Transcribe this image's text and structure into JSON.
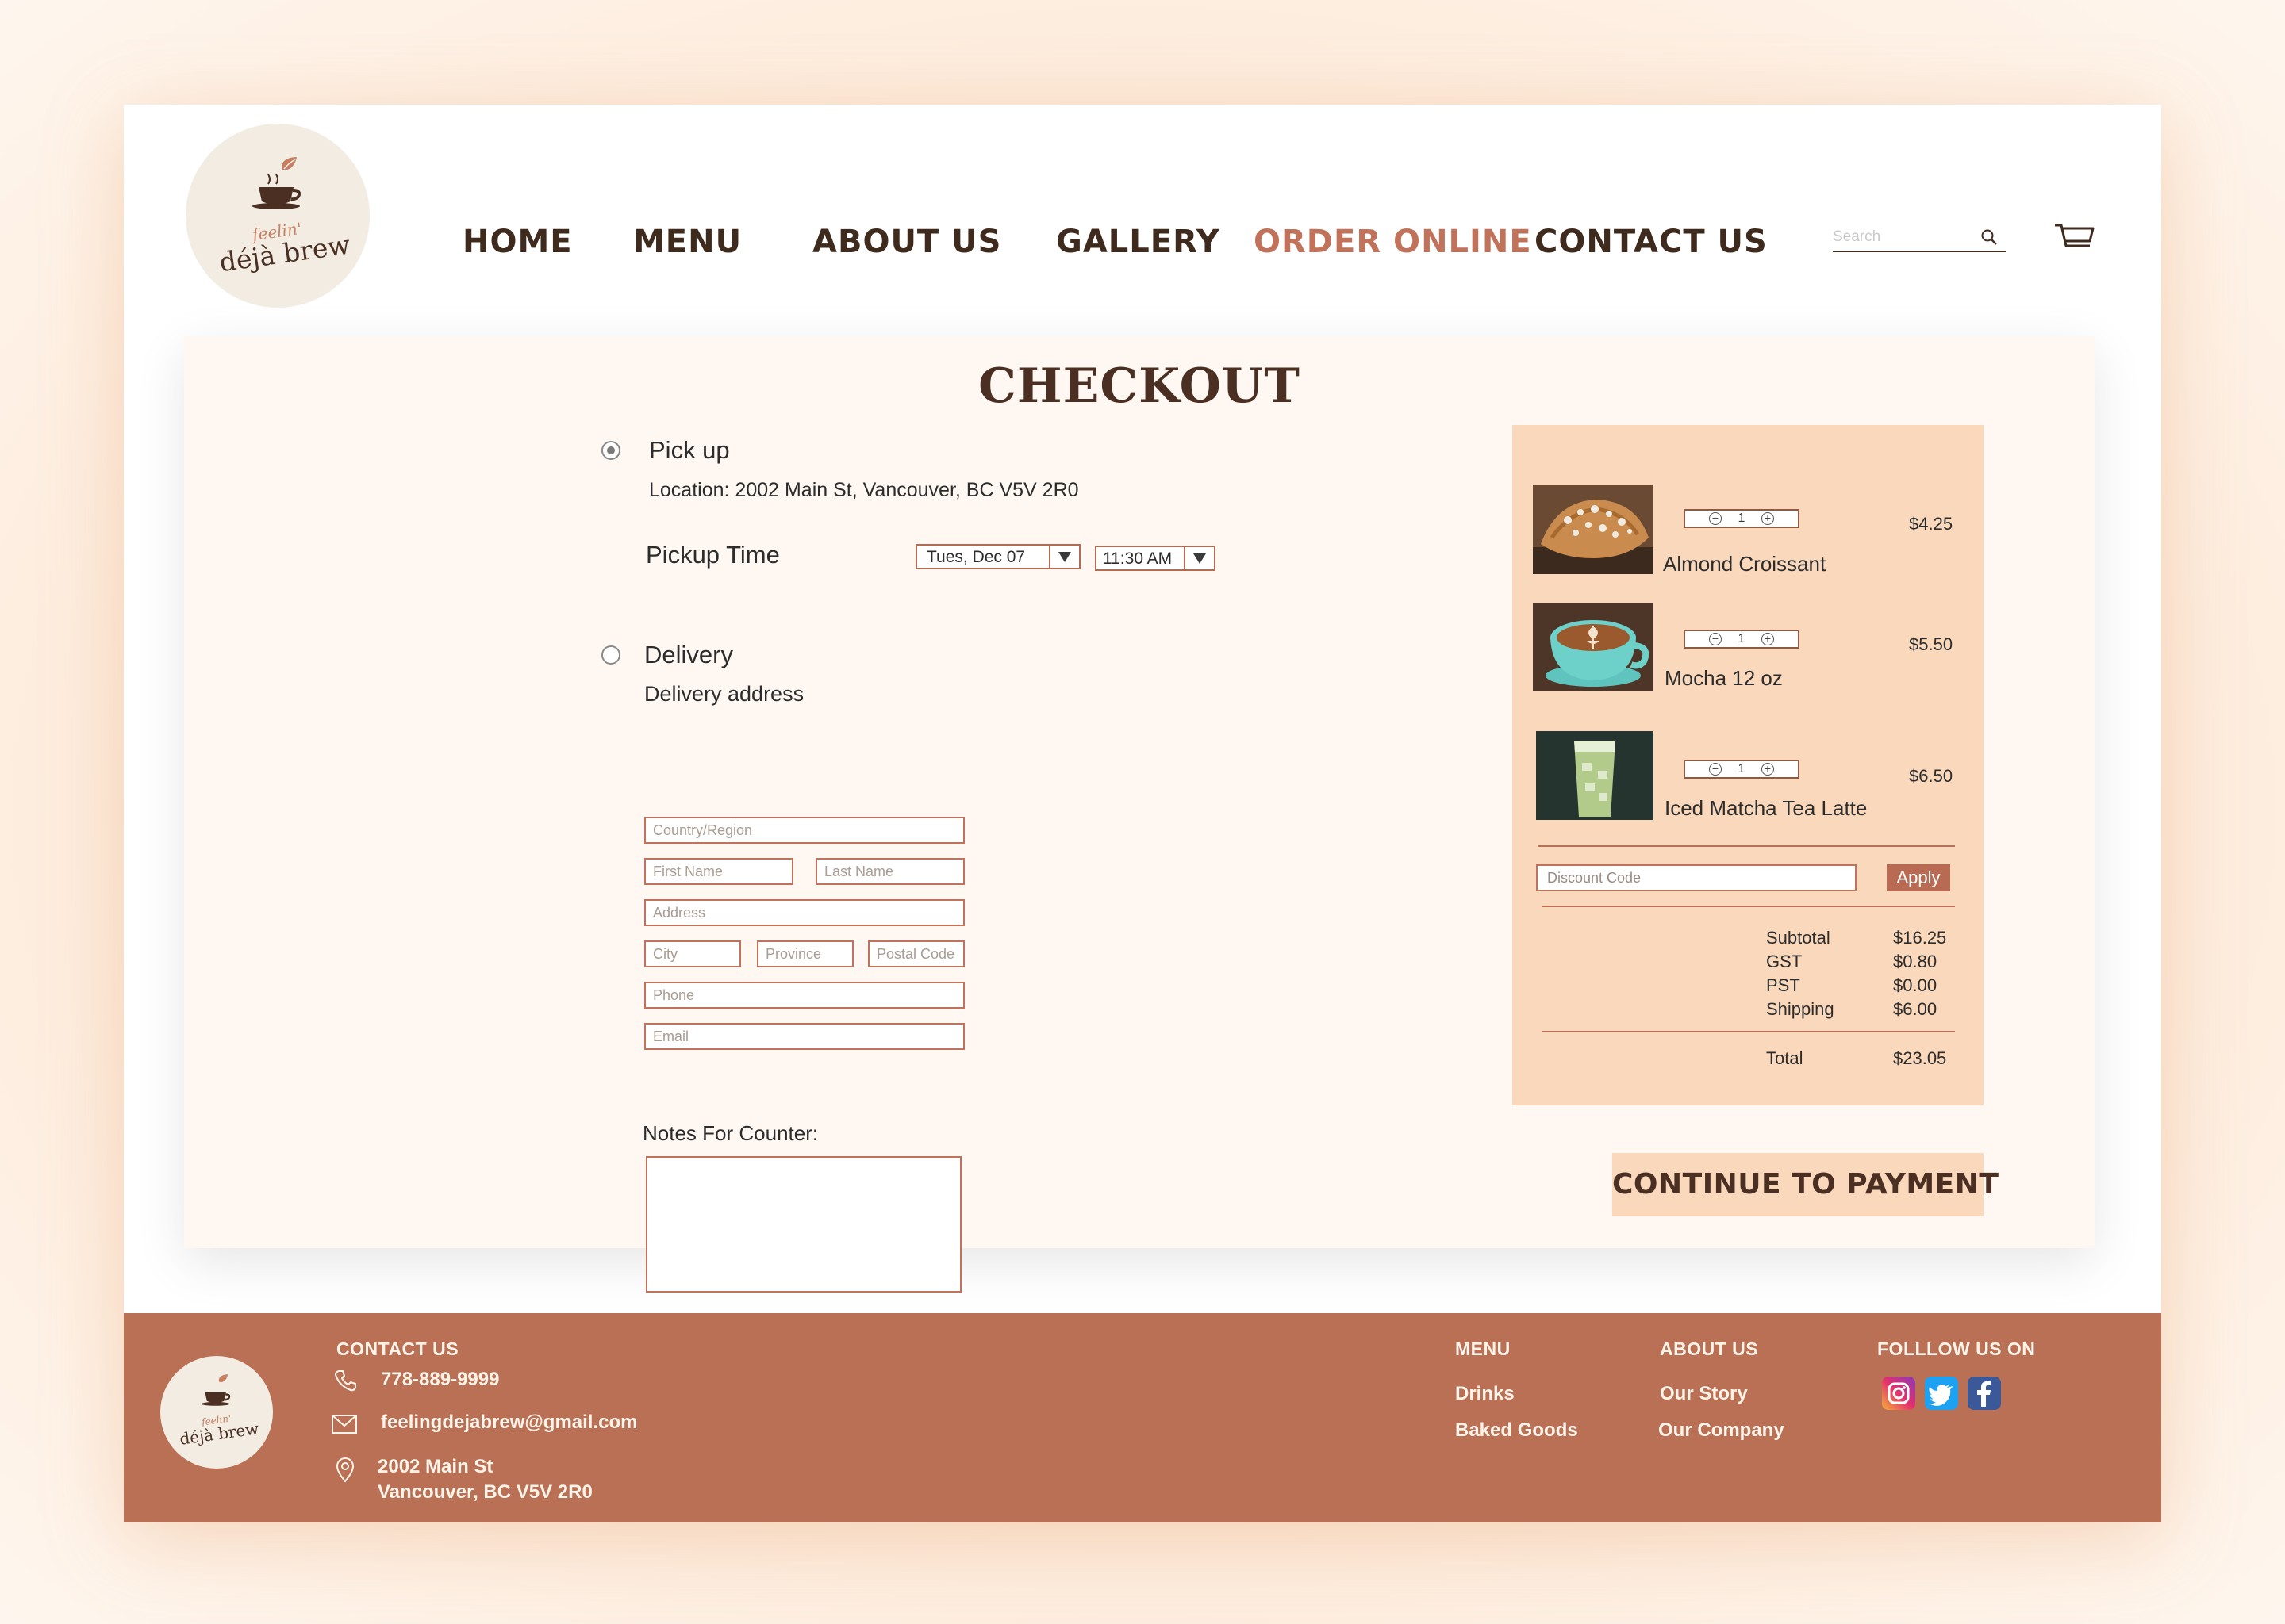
{
  "brand": {
    "tagline": "feelin'",
    "name": "déjà brew"
  },
  "nav": {
    "items": [
      {
        "label": "HOME"
      },
      {
        "label": "MENU"
      },
      {
        "label": "ABOUT US"
      },
      {
        "label": "GALLERY"
      },
      {
        "label": "ORDER ONLINE",
        "active": true
      },
      {
        "label": "CONTACT US"
      }
    ],
    "active_color": "#c0735a"
  },
  "search": {
    "placeholder": "Search"
  },
  "checkout": {
    "title": "CHECKOUT",
    "pickup": {
      "label": "Pick up",
      "selected": true,
      "location": "Location: 2002 Main St, Vancouver, BC V5V 2R0",
      "time_label": "Pickup Time",
      "date_value": "Tues, Dec 07",
      "time_value": "11:30 AM"
    },
    "delivery": {
      "label": "Delivery",
      "selected": false,
      "address_label": "Delivery address",
      "fields": {
        "country": "Country/Region",
        "first_name": "First Name",
        "last_name": "Last Name",
        "address": "Address",
        "city": "City",
        "province": "Province",
        "postal_code": "Postal Code",
        "phone": "Phone",
        "email": "Email"
      }
    },
    "notes_label": "Notes For Counter:"
  },
  "summary": {
    "items": [
      {
        "name": "Almond Croissant",
        "qty": "1",
        "price": "$4.25"
      },
      {
        "name": "Mocha 12 oz",
        "qty": "1",
        "price": "$5.50"
      },
      {
        "name": "Iced Matcha Tea Latte",
        "qty": "1",
        "price": "$6.50"
      }
    ],
    "discount_placeholder": "Discount Code",
    "apply_label": "Apply",
    "totals": [
      {
        "label": "Subtotal",
        "value": "$16.25"
      },
      {
        "label": "GST",
        "value": "$0.80"
      },
      {
        "label": "PST",
        "value": "$0.00"
      },
      {
        "label": "Shipping",
        "value": "$6.00"
      }
    ],
    "total": {
      "label": "Total",
      "value": "$23.05"
    },
    "background": "#fad8bb"
  },
  "cta_label": "CONTINUE TO PAYMENT",
  "footer": {
    "contact_heading": "CONTACT US",
    "phone": "778-889-9999",
    "email": "feelingdejabrew@gmail.com",
    "address_line1": "2002 Main St",
    "address_line2": "Vancouver, BC V5V 2R0",
    "menu_heading": "MENU",
    "menu_links": [
      "Drinks",
      "Baked Goods"
    ],
    "about_heading": "ABOUT US",
    "about_links": [
      "Our Story",
      "Our Company"
    ],
    "follow_heading": "FOLLLOW US ON",
    "social": [
      "instagram-icon",
      "twitter-icon",
      "facebook-icon"
    ],
    "background": "#ba7054"
  }
}
